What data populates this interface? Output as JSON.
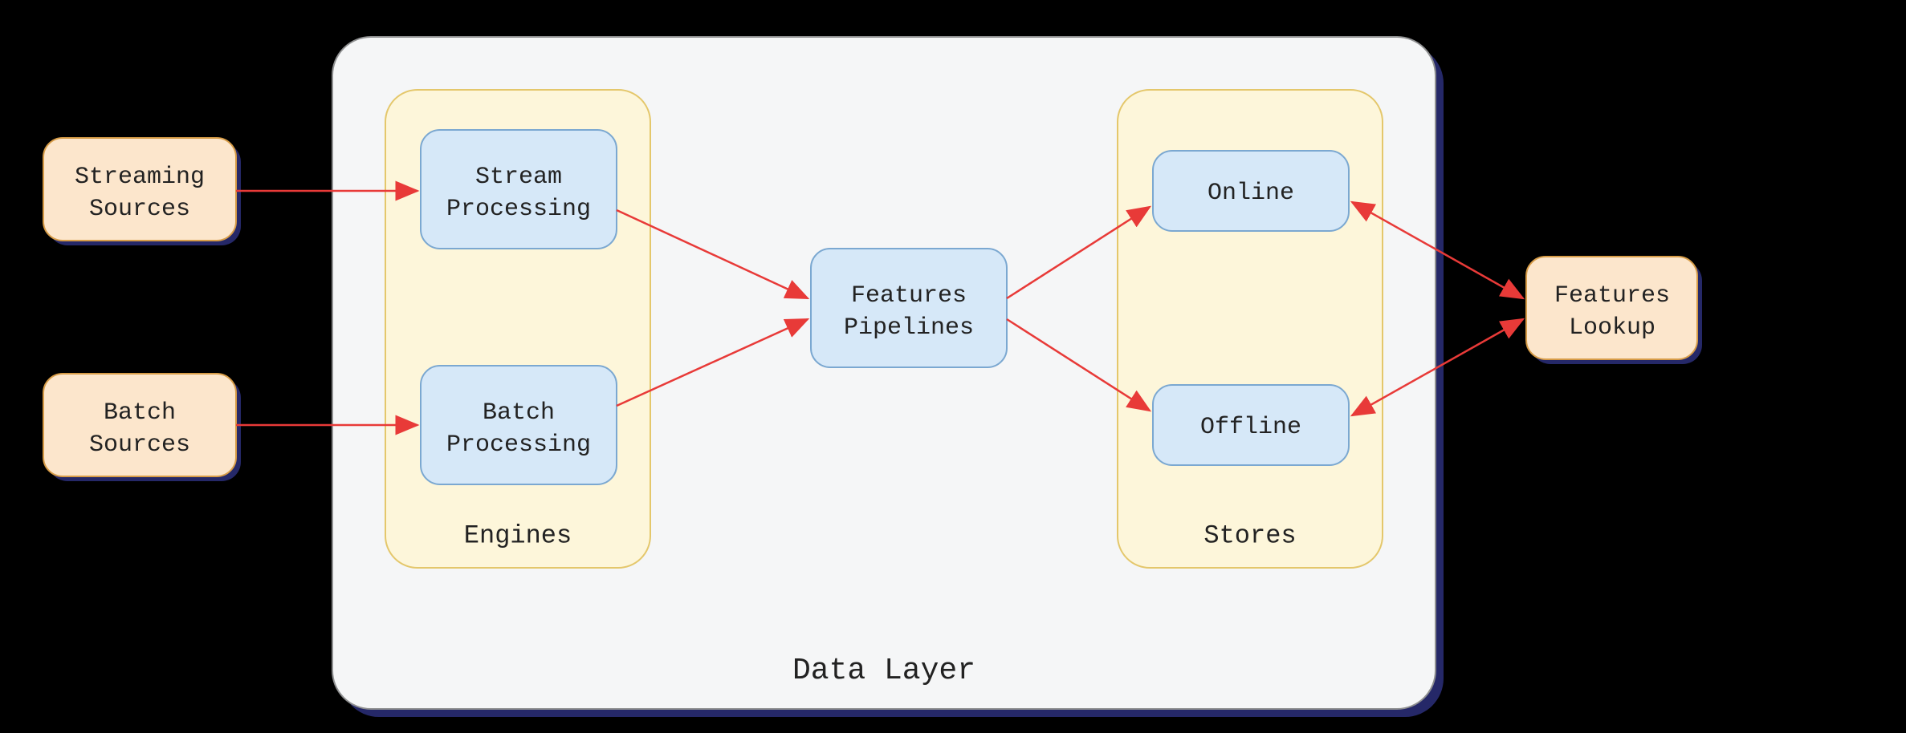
{
  "nodes": {
    "streaming_sources": {
      "line1": "Streaming",
      "line2": "Sources"
    },
    "batch_sources": {
      "line1": "Batch",
      "line2": "Sources"
    },
    "stream_processing": {
      "line1": "Stream",
      "line2": "Processing"
    },
    "batch_processing": {
      "line1": "Batch",
      "line2": "Processing"
    },
    "features_pipelines": {
      "line1": "Features",
      "line2": "Pipelines"
    },
    "online": {
      "line1": "Online"
    },
    "offline": {
      "line1": "Offline"
    },
    "features_lookup": {
      "line1": "Features",
      "line2": "Lookup"
    }
  },
  "groups": {
    "engines": {
      "caption": "Engines"
    },
    "stores": {
      "caption": "Stores"
    },
    "data_layer": {
      "caption": "Data Layer"
    }
  },
  "edges": [
    {
      "from": "streaming_sources",
      "to": "stream_processing",
      "bidirectional": false
    },
    {
      "from": "batch_sources",
      "to": "batch_processing",
      "bidirectional": false
    },
    {
      "from": "stream_processing",
      "to": "features_pipelines",
      "bidirectional": false
    },
    {
      "from": "batch_processing",
      "to": "features_pipelines",
      "bidirectional": false
    },
    {
      "from": "features_pipelines",
      "to": "online",
      "bidirectional": false
    },
    {
      "from": "features_pipelines",
      "to": "offline",
      "bidirectional": false
    },
    {
      "from": "online",
      "to": "features_lookup",
      "bidirectional": true
    },
    {
      "from": "offline",
      "to": "features_lookup",
      "bidirectional": true
    }
  ],
  "colors": {
    "orange_fill": "#FCE6CC",
    "orange_stroke": "#D79C47",
    "blue_fill": "#D6E8F8",
    "blue_stroke": "#7BA8D1",
    "yellow_fill": "#FDF6DA",
    "yellow_stroke": "#E4C76B",
    "gray_fill": "#F5F6F7",
    "gray_stroke": "#8E8F90",
    "arrow": "#E83A38",
    "shadow": "#2C2F7A",
    "background": "#000000"
  }
}
